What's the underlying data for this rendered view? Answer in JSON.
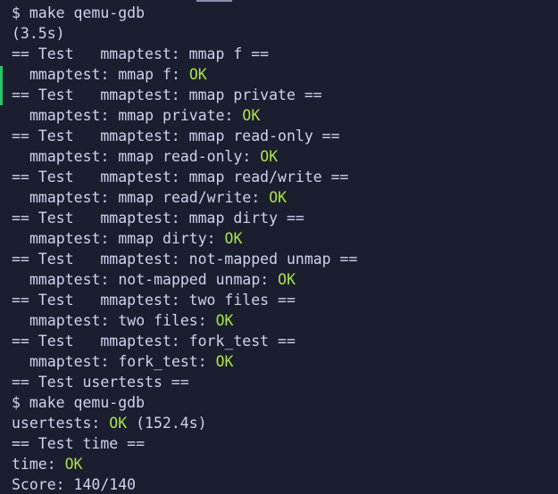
{
  "terminal": {
    "lines": [
      {
        "text": "$ make qemu-gdb"
      },
      {
        "text": "(3.5s)"
      },
      {
        "text": "== Test   mmaptest: mmap f =="
      },
      {
        "text": "mmaptest: mmap f: ",
        "status": "OK"
      },
      {
        "text": "== Test   mmaptest: mmap private =="
      },
      {
        "text": "mmaptest: mmap private: ",
        "status": "OK"
      },
      {
        "text": "== Test   mmaptest: mmap read-only =="
      },
      {
        "text": "mmaptest: mmap read-only: ",
        "status": "OK"
      },
      {
        "text": "== Test   mmaptest: mmap read/write =="
      },
      {
        "text": "mmaptest: mmap read/write: ",
        "status": "OK"
      },
      {
        "text": "== Test   mmaptest: mmap dirty =="
      },
      {
        "text": "mmaptest: mmap dirty: ",
        "status": "OK"
      },
      {
        "text": "== Test   mmaptest: not-mapped unmap =="
      },
      {
        "text": "mmaptest: not-mapped unmap: ",
        "status": "OK"
      },
      {
        "text": "== Test   mmaptest: two files =="
      },
      {
        "text": "mmaptest: two files: ",
        "status": "OK"
      },
      {
        "text": "== Test   mmaptest: fork_test =="
      },
      {
        "text": "mmaptest: fork_test: ",
        "status": "OK"
      },
      {
        "text": "== Test usertests =="
      },
      {
        "text": "$ make qemu-gdb"
      },
      {
        "text": "usertests: ",
        "status": "OK",
        "suffix": " (152.4s)"
      },
      {
        "text": "== Test time =="
      },
      {
        "text": "time: ",
        "status": "OK"
      },
      {
        "text": "Score: 140/140"
      }
    ]
  },
  "colors": {
    "background": "#1b1e2e",
    "text": "#cdd3f2",
    "ok": "#a9e34b",
    "gutter_marker": "#27c46a"
  }
}
